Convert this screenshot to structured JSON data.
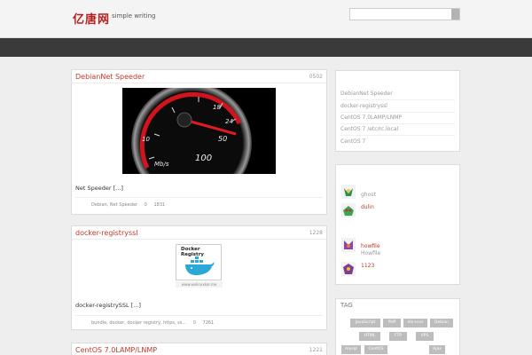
{
  "header": {
    "logo": "亿唐网",
    "tagline": "simple writing",
    "search_placeholder": ""
  },
  "posts": [
    {
      "title": "DebianNet Speeder",
      "date": "0502",
      "excerpt": "Net Speeder  [...]",
      "meta_tags": "Debian, Net Speeder",
      "comments": "0",
      "views": "1831",
      "image": {
        "ticks": [
          "10",
          "18",
          "24",
          "50",
          "100"
        ],
        "unit": "Mb/s"
      }
    },
    {
      "title": "docker-registryssl",
      "date": "1228",
      "excerpt": "docker-registrySSL [...]",
      "meta_tags": "bundle, docker, docker registry, https, ss...",
      "comments": "0",
      "views": "7261",
      "image": {
        "title": "Docker Registry",
        "caption": "www.welinuxker.me"
      }
    },
    {
      "title": "CentOS 7.0LAMP/LNMP",
      "date": "1221"
    }
  ],
  "sidebar": {
    "recent": [
      "DebianNet Speeder",
      "docker-registryssl",
      "CentOS 7.0LAMP/LNMP",
      "CentOS 7 /etc/rc.local",
      "CentOS 7"
    ],
    "users": [
      {
        "name": "ghost",
        "sub": "",
        "avatar_color": "#2e8b57"
      },
      {
        "name": "dulin",
        "sub": "",
        "avatar_color": "#3aa655"
      },
      {
        "name": "howfile",
        "sub": "Howfile",
        "avatar_color": "#8e44ad"
      },
      {
        "name": "1123",
        "sub": "",
        "avatar_color": "#7d3c98"
      }
    ],
    "tag_title": "TAG",
    "tags": [
      "JavaScript",
      "PHP",
      "div+css",
      "Debian",
      "HTML",
      "FTP",
      "VPS",
      "mysql",
      "CentOS",
      "Ajax"
    ]
  },
  "colors": {
    "accent": "#c0392b",
    "nav": "#3a3a3a",
    "tag_bg": "#bdbdbd"
  }
}
